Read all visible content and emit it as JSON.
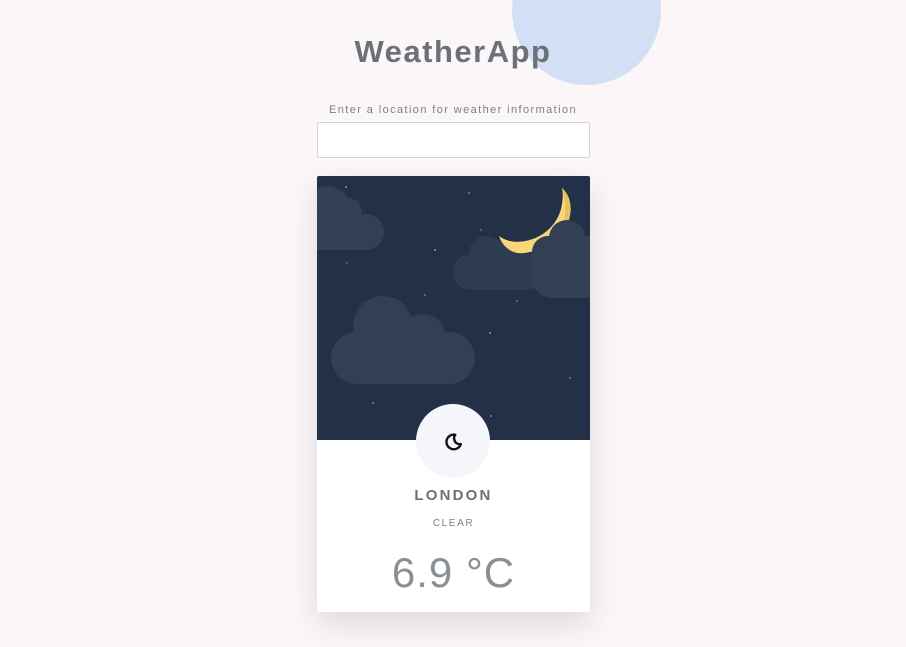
{
  "app": {
    "title": "WeatherApp"
  },
  "search": {
    "label": "Enter a location for weather information",
    "value": "",
    "placeholder": ""
  },
  "weather": {
    "city": "LONDON",
    "condition": "CLEAR",
    "temperature": "6.9 °C",
    "scene": "night",
    "icon": "moon-icon"
  },
  "colors": {
    "background": "#fbf7f8",
    "accent_circle": "#d3dff5",
    "night_sky": "#233048",
    "cloud": "#323f55",
    "moon": "#f7d77a",
    "text": "#6b7079"
  }
}
